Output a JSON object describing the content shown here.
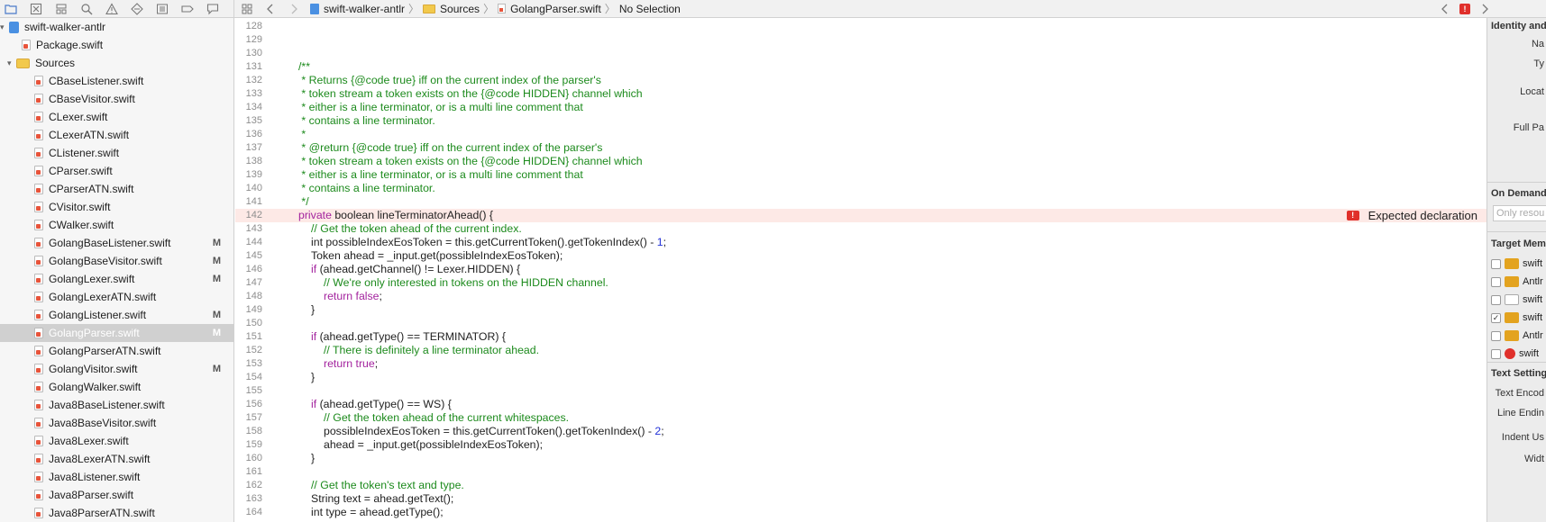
{
  "toolbar": {
    "icons": [
      "folder-icon",
      "close-square-icon",
      "hierarchy-icon",
      "search-icon",
      "warning-icon",
      "diamond-icon",
      "list-icon",
      "tag-icon",
      "comment-icon"
    ],
    "breadcrumb": [
      {
        "label": "swift-walker-antlr",
        "icon": "project-icon"
      },
      {
        "label": "Sources",
        "icon": "folder-icon"
      },
      {
        "label": "GolangParser.swift",
        "icon": "swift-file-icon"
      },
      {
        "label": "No Selection",
        "icon": ""
      }
    ]
  },
  "sidebar": {
    "project": "swift-walker-antlr",
    "items": [
      {
        "label": "Package.swift",
        "indent": 1,
        "kind": "file",
        "badge": ""
      },
      {
        "label": "Sources",
        "indent": 0,
        "kind": "folder",
        "badge": ""
      },
      {
        "label": "CBaseListener.swift",
        "indent": 2,
        "kind": "file",
        "badge": ""
      },
      {
        "label": "CBaseVisitor.swift",
        "indent": 2,
        "kind": "file",
        "badge": ""
      },
      {
        "label": "CLexer.swift",
        "indent": 2,
        "kind": "file",
        "badge": ""
      },
      {
        "label": "CLexerATN.swift",
        "indent": 2,
        "kind": "file",
        "badge": ""
      },
      {
        "label": "CListener.swift",
        "indent": 2,
        "kind": "file",
        "badge": ""
      },
      {
        "label": "CParser.swift",
        "indent": 2,
        "kind": "file",
        "badge": ""
      },
      {
        "label": "CParserATN.swift",
        "indent": 2,
        "kind": "file",
        "badge": ""
      },
      {
        "label": "CVisitor.swift",
        "indent": 2,
        "kind": "file",
        "badge": ""
      },
      {
        "label": "CWalker.swift",
        "indent": 2,
        "kind": "file",
        "badge": ""
      },
      {
        "label": "GolangBaseListener.swift",
        "indent": 2,
        "kind": "file",
        "badge": "M"
      },
      {
        "label": "GolangBaseVisitor.swift",
        "indent": 2,
        "kind": "file",
        "badge": "M"
      },
      {
        "label": "GolangLexer.swift",
        "indent": 2,
        "kind": "file",
        "badge": "M"
      },
      {
        "label": "GolangLexerATN.swift",
        "indent": 2,
        "kind": "file",
        "badge": ""
      },
      {
        "label": "GolangListener.swift",
        "indent": 2,
        "kind": "file",
        "badge": "M"
      },
      {
        "label": "GolangParser.swift",
        "indent": 2,
        "kind": "file",
        "badge": "M"
      },
      {
        "label": "GolangParserATN.swift",
        "indent": 2,
        "kind": "file",
        "badge": ""
      },
      {
        "label": "GolangVisitor.swift",
        "indent": 2,
        "kind": "file",
        "badge": "M"
      },
      {
        "label": "GolangWalker.swift",
        "indent": 2,
        "kind": "file",
        "badge": ""
      },
      {
        "label": "Java8BaseListener.swift",
        "indent": 2,
        "kind": "file",
        "badge": ""
      },
      {
        "label": "Java8BaseVisitor.swift",
        "indent": 2,
        "kind": "file",
        "badge": ""
      },
      {
        "label": "Java8Lexer.swift",
        "indent": 2,
        "kind": "file",
        "badge": ""
      },
      {
        "label": "Java8LexerATN.swift",
        "indent": 2,
        "kind": "file",
        "badge": ""
      },
      {
        "label": "Java8Listener.swift",
        "indent": 2,
        "kind": "file",
        "badge": ""
      },
      {
        "label": "Java8Parser.swift",
        "indent": 2,
        "kind": "file",
        "badge": ""
      },
      {
        "label": "Java8ParserATN.swift",
        "indent": 2,
        "kind": "file",
        "badge": ""
      }
    ],
    "selected_index": 16
  },
  "editor": {
    "error_line": 142,
    "error_message": "Expected declaration",
    "lines": [
      {
        "n": "128",
        "indent": 0,
        "tokens": []
      },
      {
        "n": "129",
        "indent": 0,
        "tokens": []
      },
      {
        "n": "130",
        "indent": 0,
        "tokens": []
      },
      {
        "n": "131",
        "indent": 0,
        "tokens": [
          {
            "t": "/**",
            "k": "com"
          }
        ]
      },
      {
        "n": "132",
        "indent": 0,
        "tokens": [
          {
            "t": " * Returns {@code true} iff on the current index of the parser's",
            "k": "com"
          }
        ]
      },
      {
        "n": "133",
        "indent": 0,
        "tokens": [
          {
            "t": " * token stream a token exists on the {@code HIDDEN} channel which",
            "k": "com"
          }
        ]
      },
      {
        "n": "134",
        "indent": 0,
        "tokens": [
          {
            "t": " * either is a line terminator, or is a multi line comment that",
            "k": "com"
          }
        ]
      },
      {
        "n": "135",
        "indent": 0,
        "tokens": [
          {
            "t": " * contains a line terminator.",
            "k": "com"
          }
        ]
      },
      {
        "n": "136",
        "indent": 0,
        "tokens": [
          {
            "t": " *",
            "k": "com"
          }
        ]
      },
      {
        "n": "137",
        "indent": 0,
        "tokens": [
          {
            "t": " * @return {@code true} iff on the current index of the parser's",
            "k": "com"
          }
        ]
      },
      {
        "n": "138",
        "indent": 0,
        "tokens": [
          {
            "t": " * token stream a token exists on the {@code HIDDEN} channel which",
            "k": "com"
          }
        ]
      },
      {
        "n": "139",
        "indent": 0,
        "tokens": [
          {
            "t": " * either is a line terminator, or is a multi line comment that",
            "k": "com"
          }
        ]
      },
      {
        "n": "140",
        "indent": 0,
        "tokens": [
          {
            "t": " * contains a line terminator.",
            "k": "com"
          }
        ]
      },
      {
        "n": "141",
        "indent": 0,
        "tokens": [
          {
            "t": " */",
            "k": "com"
          }
        ]
      },
      {
        "n": "142",
        "indent": 0,
        "tokens": [
          {
            "t": "private ",
            "k": "kw"
          },
          {
            "t": "boolean lineTerminatorAhead() {",
            "k": "plain"
          }
        ]
      },
      {
        "n": "143",
        "indent": 1,
        "tokens": [
          {
            "t": "// Get the token ahead of the current index.",
            "k": "com"
          }
        ]
      },
      {
        "n": "144",
        "indent": 1,
        "tokens": [
          {
            "t": "int possibleIndexEosToken = this.getCurrentToken().getTokenIndex() - ",
            "k": "plain"
          },
          {
            "t": "1",
            "k": "num"
          },
          {
            "t": ";",
            "k": "plain"
          }
        ]
      },
      {
        "n": "145",
        "indent": 1,
        "tokens": [
          {
            "t": "Token ahead = _input.get(possibleIndexEosToken);",
            "k": "plain"
          }
        ]
      },
      {
        "n": "146",
        "indent": 1,
        "tokens": [
          {
            "t": "if ",
            "k": "kw"
          },
          {
            "t": "(ahead.getChannel() != Lexer.HIDDEN) {",
            "k": "plain"
          }
        ]
      },
      {
        "n": "147",
        "indent": 2,
        "tokens": [
          {
            "t": "// We're only interested in tokens on the HIDDEN channel.",
            "k": "com"
          }
        ]
      },
      {
        "n": "148",
        "indent": 2,
        "tokens": [
          {
            "t": "return false",
            "k": "kw"
          },
          {
            "t": ";",
            "k": "plain"
          }
        ]
      },
      {
        "n": "149",
        "indent": 1,
        "tokens": [
          {
            "t": "}",
            "k": "plain"
          }
        ]
      },
      {
        "n": "150",
        "indent": 0,
        "tokens": []
      },
      {
        "n": "151",
        "indent": 1,
        "tokens": [
          {
            "t": "if ",
            "k": "kw"
          },
          {
            "t": "(ahead.getType() == TERMINATOR) {",
            "k": "plain"
          }
        ]
      },
      {
        "n": "152",
        "indent": 2,
        "tokens": [
          {
            "t": "// There is definitely a line terminator ahead.",
            "k": "com"
          }
        ]
      },
      {
        "n": "153",
        "indent": 2,
        "tokens": [
          {
            "t": "return true",
            "k": "kw"
          },
          {
            "t": ";",
            "k": "plain"
          }
        ]
      },
      {
        "n": "154",
        "indent": 1,
        "tokens": [
          {
            "t": "}",
            "k": "plain"
          }
        ]
      },
      {
        "n": "155",
        "indent": 0,
        "tokens": []
      },
      {
        "n": "156",
        "indent": 1,
        "tokens": [
          {
            "t": "if ",
            "k": "kw"
          },
          {
            "t": "(ahead.getType() == WS) {",
            "k": "plain"
          }
        ]
      },
      {
        "n": "157",
        "indent": 2,
        "tokens": [
          {
            "t": "// Get the token ahead of the current whitespaces.",
            "k": "com"
          }
        ]
      },
      {
        "n": "158",
        "indent": 2,
        "tokens": [
          {
            "t": "possibleIndexEosToken = this.getCurrentToken().getTokenIndex() - ",
            "k": "plain"
          },
          {
            "t": "2",
            "k": "num"
          },
          {
            "t": ";",
            "k": "plain"
          }
        ]
      },
      {
        "n": "159",
        "indent": 2,
        "tokens": [
          {
            "t": "ahead = _input.get(possibleIndexEosToken);",
            "k": "plain"
          }
        ]
      },
      {
        "n": "160",
        "indent": 1,
        "tokens": [
          {
            "t": "}",
            "k": "plain"
          }
        ]
      },
      {
        "n": "161",
        "indent": 0,
        "tokens": []
      },
      {
        "n": "162",
        "indent": 1,
        "tokens": [
          {
            "t": "// Get the token's text and type.",
            "k": "com"
          }
        ]
      },
      {
        "n": "163",
        "indent": 1,
        "tokens": [
          {
            "t": "String text = ahead.getText();",
            "k": "plain"
          }
        ]
      },
      {
        "n": "164",
        "indent": 1,
        "tokens": [
          {
            "t": "int type = ahead.getType();",
            "k": "plain"
          }
        ]
      }
    ]
  },
  "inspector": {
    "identity_heading": "Identity and",
    "name_label": "Na",
    "type_label": "Ty",
    "location_label": "Locat",
    "fullpath_label": "Full Pa",
    "on_demand_heading": "On Demand",
    "on_demand_placeholder": "Only resou",
    "target_heading": "Target Mem",
    "targets": [
      {
        "label": "swift",
        "checked": false,
        "icon": "toolbox-icon"
      },
      {
        "label": "Antlr",
        "checked": false,
        "icon": "toolbox-icon"
      },
      {
        "label": "swift",
        "checked": false,
        "icon": "folder-outline-icon"
      },
      {
        "label": "swift",
        "checked": true,
        "icon": "toolbox-icon"
      },
      {
        "label": "Antlr",
        "checked": false,
        "icon": "toolbox-icon"
      },
      {
        "label": "swift",
        "checked": false,
        "icon": "target-icon"
      }
    ],
    "text_settings_heading": "Text Setting",
    "text_encoding_label": "Text Encod",
    "line_endings_label": "Line Endin",
    "indent_label": "Indent Us",
    "widths_label": "Widt"
  }
}
